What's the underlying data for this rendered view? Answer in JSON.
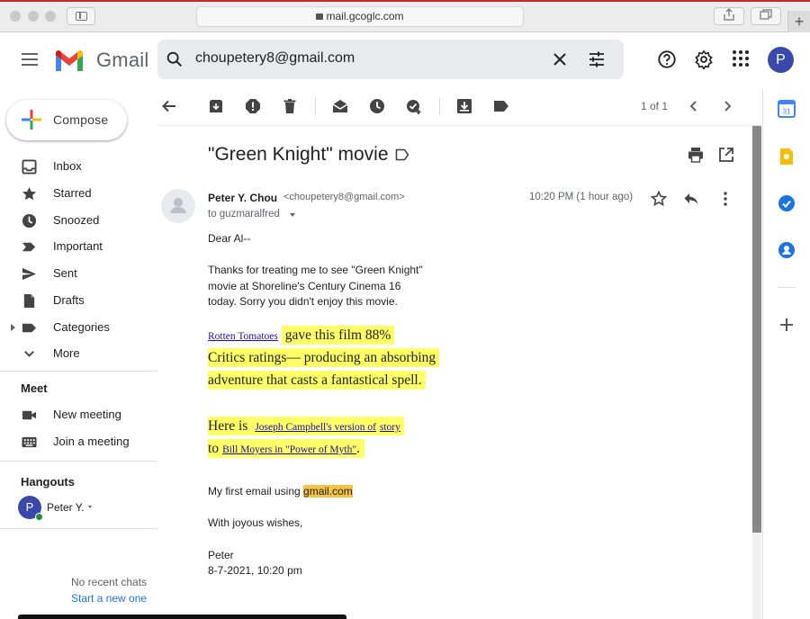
{
  "browser": {
    "url": "mail.gcoglc.com",
    "new_tab_label": "+"
  },
  "header": {
    "app_name": "Gmail",
    "search_query": "choupetery8@gmail.com",
    "avatar_letter": "P"
  },
  "compose": {
    "label": "Compose"
  },
  "sidebar": {
    "items": [
      {
        "label": "Inbox",
        "icon": "inbox-icon"
      },
      {
        "label": "Starred",
        "icon": "star-icon"
      },
      {
        "label": "Snoozed",
        "icon": "clock-icon"
      },
      {
        "label": "Important",
        "icon": "important-icon"
      },
      {
        "label": "Sent",
        "icon": "send-icon"
      },
      {
        "label": "Drafts",
        "icon": "draft-icon"
      },
      {
        "label": "Categories",
        "icon": "label-icon"
      },
      {
        "label": "More",
        "icon": "chevron-down-icon"
      }
    ],
    "meet_title": "Meet",
    "meet_items": [
      {
        "label": "New meeting",
        "icon": "video-icon"
      },
      {
        "label": "Join a meeting",
        "icon": "keyboard-icon"
      }
    ],
    "hangouts_title": "Hangouts",
    "hangouts_user": "Peter Y.",
    "hangouts_avatar_letter": "P",
    "no_chats": "No recent chats",
    "start_new": "Start a new one"
  },
  "toolbar": {
    "pager": "1 of 1"
  },
  "message": {
    "subject": "\"Green Knight\" movie",
    "sender_name": "Peter Y. Chou",
    "sender_email": "<choupetery8@gmail.com>",
    "to": "to guzmaralfred",
    "time": "10:20 PM (1 hour ago)",
    "greeting": "Dear Al--",
    "para1": [
      "Thanks for treating me to see \"Green Knight\"",
      "movie at Shoreline's Century Cinema 16",
      "today. Sorry you didn't enjoy this movie."
    ],
    "rt_link": "Rotten Tomatoes",
    "rt_line1": "gave this film 88%",
    "rt_line2": "Critics ratings— producing an absorbing",
    "rt_line3": "adventure that casts a fantastical spell.",
    "here_is": "Here is",
    "campbell_link": "Joseph Campbell's version of",
    "story_link": "story",
    "to_word": "to",
    "moyers_link": "Bill Moyers in \"Power of Myth\"",
    "period": ".",
    "first_email_prefix": "My first email using",
    "gmail_link": "gmail.com",
    "closing": "With joyous wishes,",
    "signature_name": "Peter",
    "signature_date": "8-7-2021, 10:20 pm"
  },
  "colors": {
    "highlight": "#ffff66",
    "gmail_highlight": "#f6c343",
    "avatar": "#3949ab",
    "link": "#1a0dab"
  }
}
